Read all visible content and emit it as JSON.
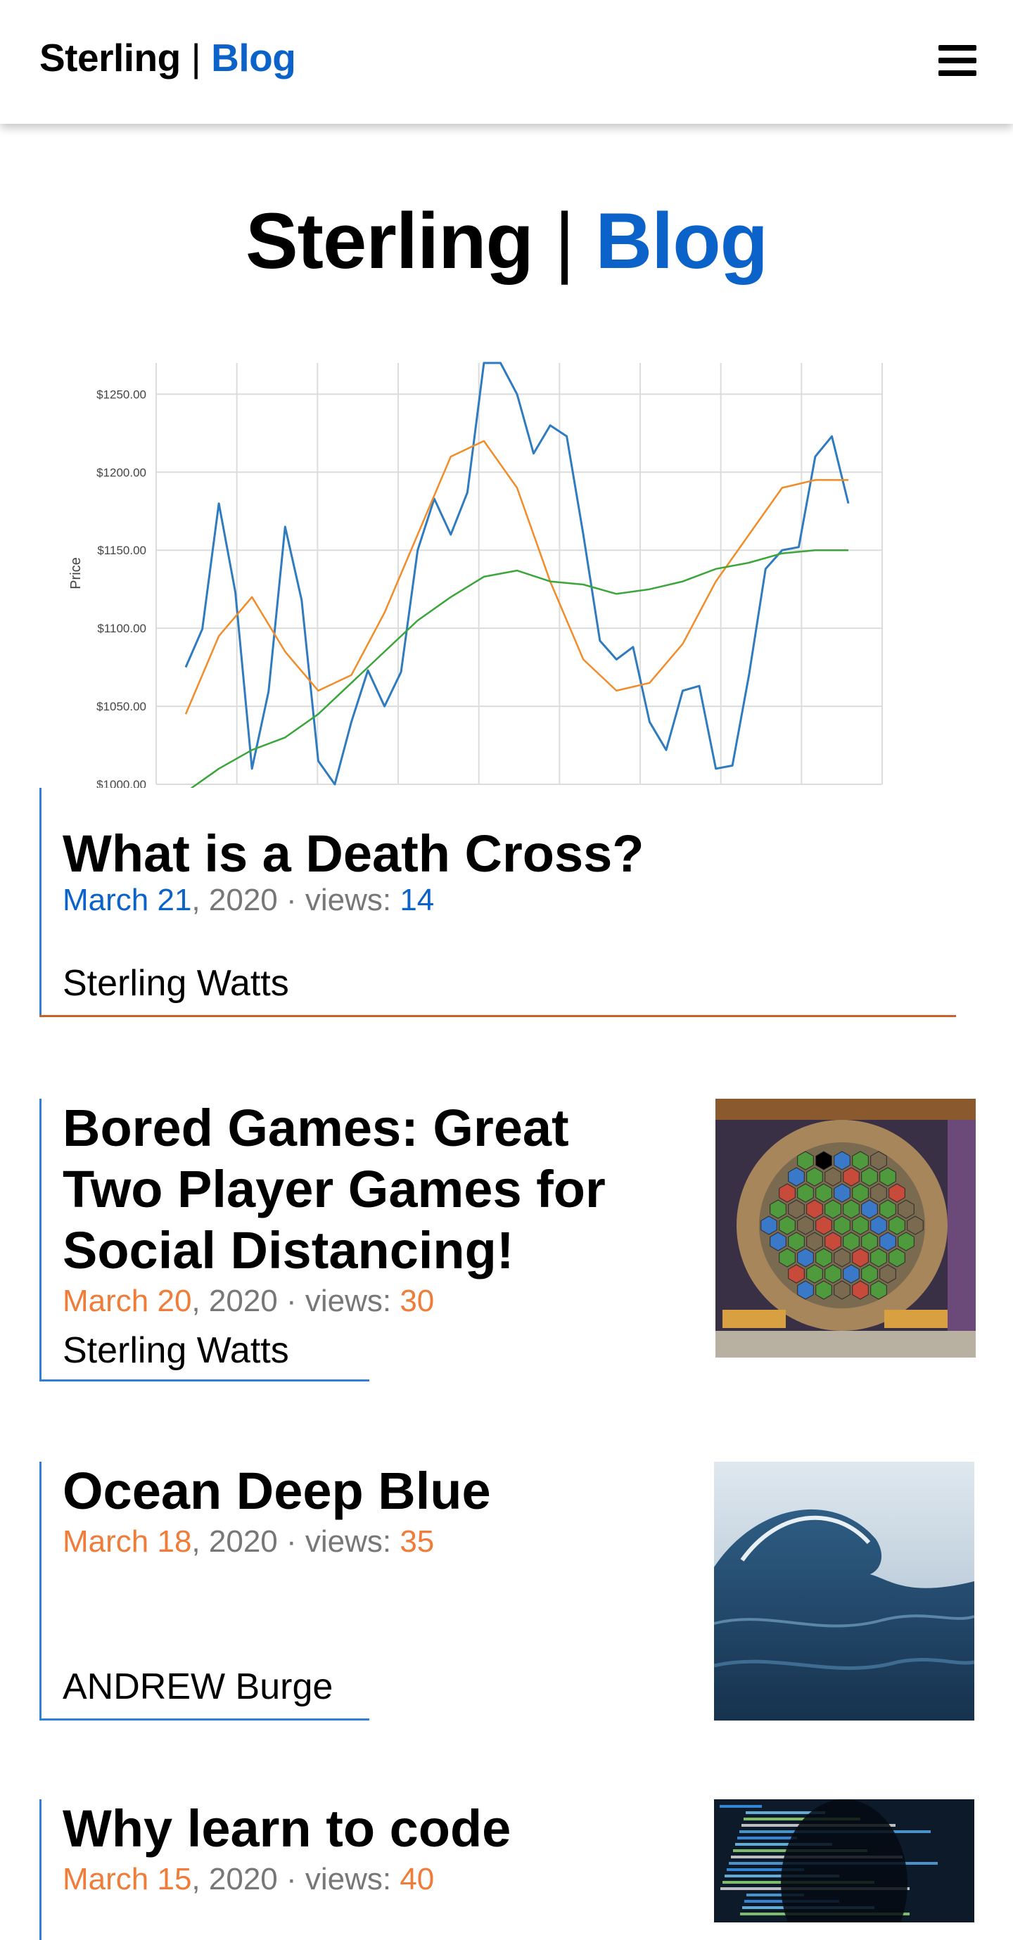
{
  "header": {
    "brand_name": "Sterling",
    "brand_sep": " | ",
    "brand_suffix": "Blog"
  },
  "hero": {
    "name": "Sterling",
    "sep": " | ",
    "suffix": "Blog"
  },
  "chart_data": {
    "type": "line",
    "title": "",
    "xlabel": "",
    "ylabel": "Price",
    "ylim": [
      1000,
      1270
    ],
    "yticks": [
      "$1000.00",
      "$1050.00",
      "$1100.00",
      "$1150.00",
      "$1200.00",
      "$1250.00"
    ],
    "ytick_values": [
      1000,
      1050,
      1100,
      1150,
      1200,
      1250
    ],
    "x": [
      0,
      5,
      10,
      15,
      20,
      25,
      30,
      35,
      40,
      45,
      50,
      55,
      60,
      65,
      70,
      75,
      80,
      85,
      90,
      95,
      100
    ],
    "series": [
      {
        "color": "#2f7bbf",
        "values": [
          1075,
          1180,
          1010,
          1165,
          1015,
          1040,
          1050,
          1150,
          1160,
          1270,
          1250,
          1230,
          1160,
          1080,
          1040,
          1060,
          1010,
          1070,
          1150,
          1210,
          1180
        ]
      },
      {
        "color": "#f28c28",
        "values": [
          1045,
          1095,
          1120,
          1085,
          1060,
          1070,
          1110,
          1160,
          1210,
          1220,
          1190,
          1130,
          1080,
          1060,
          1065,
          1090,
          1130,
          1160,
          1190,
          1195,
          1195
        ]
      },
      {
        "color": "#3aa63a",
        "values": [
          995,
          1010,
          1022,
          1030,
          1045,
          1065,
          1085,
          1105,
          1120,
          1133,
          1137,
          1130,
          1128,
          1122,
          1125,
          1130,
          1138,
          1142,
          1148,
          1150,
          1150
        ]
      }
    ]
  },
  "posts": [
    {
      "title": "What is a Death Cross?",
      "date_md": "March 21",
      "date_rest": ", 2020 · views: ",
      "views": "14",
      "author": "Sterling Watts",
      "accent": "#0b63c9",
      "rule": "#c8622a"
    },
    {
      "title": "Bored Games: Great Two Player Games for Social Distancing!",
      "date_md": "March 20",
      "date_rest": ", 2020 · views: ",
      "views": "30",
      "author": "Sterling Watts",
      "accent": "#f07c3a",
      "rule": "#2f80d7"
    },
    {
      "title": "Ocean Deep Blue",
      "date_md": "March 18",
      "date_rest": ", 2020 · views: ",
      "views": "35",
      "author": "ANDREW Burge",
      "accent": "#f07c3a",
      "rule": "#2f80d7"
    },
    {
      "title": "Why learn to code",
      "date_md": "March 15",
      "date_rest": ", 2020 · views: ",
      "views": "40",
      "author": "",
      "accent": "#f07c3a",
      "rule": "#2f80d7"
    }
  ]
}
